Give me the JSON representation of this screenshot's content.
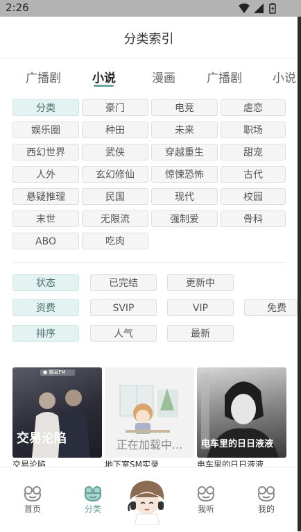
{
  "status_bar": {
    "time": "2:26"
  },
  "header": {
    "title": "分类索引"
  },
  "tabs": [
    {
      "label": "广播剧"
    },
    {
      "label": "小说"
    },
    {
      "label": "漫画"
    },
    {
      "label": "广播剧"
    },
    {
      "label": "小说"
    }
  ],
  "category": {
    "label": "分类",
    "items": [
      "豪门",
      "电竞",
      "虐恋",
      "娱乐圈",
      "种田",
      "未来",
      "职场",
      "西幻世界",
      "武侠",
      "穿越重生",
      "甜宠",
      "人外",
      "玄幻修仙",
      "惊悚恐怖",
      "古代",
      "悬疑推理",
      "民国",
      "现代",
      "校园",
      "末世",
      "无限流",
      "强制爱",
      "骨科",
      "ABO",
      "吃肉"
    ]
  },
  "filters": [
    {
      "label": "状态",
      "options": [
        "已完结",
        "更新中"
      ]
    },
    {
      "label": "资费",
      "options": [
        "SVIP",
        "VIP",
        "免费"
      ]
    },
    {
      "label": "排序",
      "options": [
        "人气",
        "最新"
      ]
    }
  ],
  "cards": [
    {
      "title": "交易沦陷",
      "cover_text": "交易沦陷",
      "cover_badge": "● 猫耳FM"
    },
    {
      "title": "地下室SM实录",
      "loading_text": "正在加载中..."
    },
    {
      "title": "电车里的日日液液",
      "cover_text": "电车里的日日液液"
    }
  ],
  "bottom_nav": [
    {
      "label": "首页",
      "icon": "frog-home-icon"
    },
    {
      "label": "分类",
      "icon": "frog-category-icon"
    },
    {
      "label": "我听",
      "icon": "frog-listen-icon"
    },
    {
      "label": "我的",
      "icon": "frog-profile-icon"
    }
  ],
  "colors": {
    "accent": "#6aa8a4",
    "chip_selected": "#e3f3f1",
    "status_bar": "#b3b3b3"
  }
}
